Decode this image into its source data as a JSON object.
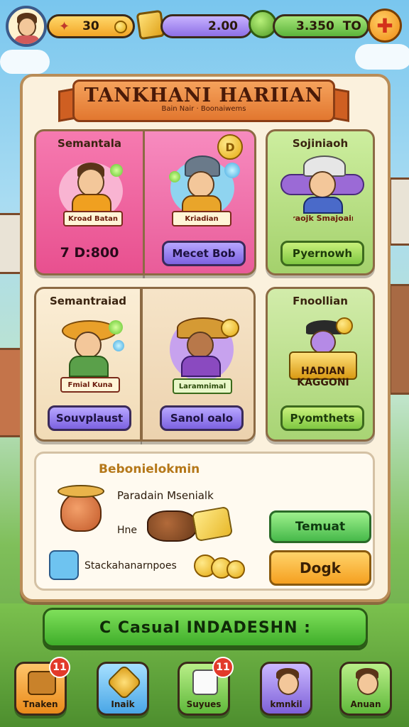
{
  "topbar": {
    "resource1": {
      "icon": "medal-icon",
      "value": "30"
    },
    "resource2": {
      "icon": "gold-cube-icon",
      "value": "2.00"
    },
    "resource3": {
      "icon": "green-gem-icon",
      "value": "3.350",
      "suffix": "TO"
    },
    "shop_icon": "shop-plus-icon"
  },
  "panel": {
    "title": "TANKHANI HARIIAN",
    "subtitle": "Bain  Nair · Boonaiwems"
  },
  "cards": [
    {
      "title": "Semantala",
      "banner": "Kroad Batan",
      "value": "7 D:800",
      "bg": "#f36aa5"
    },
    {
      "title": "",
      "banner": "Kriadian",
      "button": "Mecet Bob",
      "bg": "#f58bbf"
    },
    {
      "title": "Sojiniaoh",
      "banner": "Fraojk Smajoaini",
      "button": "Pyernowh",
      "bg": "#bfe59a"
    },
    {
      "title": "Semantraiad",
      "banner": "Fmial Kuna",
      "button": "Souvplaust",
      "bg": "#f6e3c5"
    },
    {
      "title": "",
      "banner": "Laramnimal",
      "button": "Sanol oalo",
      "bg": "#f1dcc0"
    },
    {
      "title": "Fnoollian",
      "banner": "HADIAN KAGGONI",
      "button": "Pyomthets",
      "bg": "#c9e89c"
    }
  ],
  "reward": {
    "title": "Bebonielokmin",
    "line1": "Paradain Msenialk",
    "line2": "Hne",
    "line3": "Stackahanarnpoes",
    "btn_primary": "Temuat",
    "btn_secondary": "Dogk"
  },
  "bottom_banner": {
    "text": "C  Casual  INDADESHN  :"
  },
  "nav": [
    {
      "label": "Tnaken",
      "icon": "treasure-chest-icon",
      "badge": "11",
      "bg": "#f2a43a"
    },
    {
      "label": "Inaik",
      "icon": "shield-badge-icon",
      "badge": "",
      "bg": "#6ec3f0"
    },
    {
      "label": "Suyues",
      "icon": "dice-icon",
      "badge": "11",
      "bg": "#8ed35a"
    },
    {
      "label": "kmnkil",
      "icon": "hero-portrait-icon",
      "badge": "",
      "bg": "#a58be6"
    },
    {
      "label": "Anuan",
      "icon": "friend-portrait-icon",
      "badge": "",
      "bg": "#8ed35a"
    }
  ]
}
